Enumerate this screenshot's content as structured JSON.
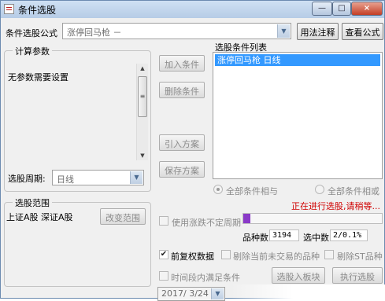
{
  "window": {
    "title": "条件选股",
    "icon": "app-icon",
    "controls": {
      "minimize": "—",
      "maximize": "□",
      "close": "×"
    }
  },
  "formula": {
    "label": "条件选股公式",
    "value": "涨停回马枪  －",
    "usage_button": "用法注释",
    "view_button": "查看公式"
  },
  "params_group": {
    "title": "计算参数",
    "text": "无参数需要设置"
  },
  "period": {
    "label": "选股周期:",
    "value": "日线"
  },
  "actions": {
    "add": "加入条件",
    "delete": "删除条件",
    "import": "引入方案",
    "save": "保存方案"
  },
  "conditions": {
    "label": "选股条件列表",
    "items": [
      "涨停回马枪  日线"
    ]
  },
  "logic": {
    "and_label": "全部条件相与",
    "or_label": "全部条件相或",
    "selected": "and"
  },
  "range_group": {
    "title": "选股范围",
    "value": "上证A股 深证A股",
    "change_button": "改变范围"
  },
  "status": {
    "text": "正在进行选股,请稍等...",
    "color": "#d00000"
  },
  "progress": {
    "fraction": 0.05,
    "color": "#8a3ac8"
  },
  "options": {
    "unstable_period": {
      "label": "使用涨跌不定周期",
      "checked": false
    },
    "pre_adjust": {
      "label": "前复权数据",
      "checked": true
    },
    "exclude_untraded": {
      "label": "剔除当前未交易的品种",
      "checked": false
    },
    "exclude_st": {
      "label": "剔除ST品种",
      "checked": false
    },
    "time_window": {
      "label": "时间段内满足条件",
      "checked": false
    }
  },
  "stats": {
    "count_label": "品种数",
    "count_value": "3194",
    "selected_label": "选中数",
    "selected_value": "2/0.1%"
  },
  "bottom": {
    "to_block_button": "选股入板块",
    "execute_button": "执行选股",
    "date": "2017/ 3/24"
  }
}
